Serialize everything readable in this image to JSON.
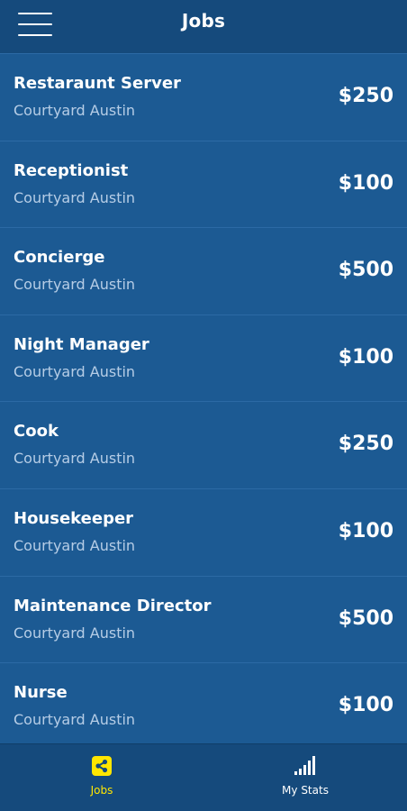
{
  "header": {
    "title": "Jobs",
    "menu_icon": "hamburger-menu-icon"
  },
  "jobs": [
    {
      "title": "Restaraunt Server",
      "location": "Courtyard Austin",
      "pay": "$250"
    },
    {
      "title": "Receptionist",
      "location": "Courtyard Austin",
      "pay": "$100"
    },
    {
      "title": "Concierge",
      "location": "Courtyard Austin",
      "pay": "$500"
    },
    {
      "title": "Night Manager",
      "location": "Courtyard Austin",
      "pay": "$100"
    },
    {
      "title": "Cook",
      "location": "Courtyard Austin",
      "pay": "$250"
    },
    {
      "title": "Housekeeper",
      "location": "Courtyard Austin",
      "pay": "$100"
    },
    {
      "title": "Maintenance Director",
      "location": "Courtyard Austin",
      "pay": "$500"
    },
    {
      "title": "Nurse",
      "location": "Courtyard Austin",
      "pay": "$100"
    }
  ],
  "tabbar": {
    "tabs": [
      {
        "label": "Jobs",
        "icon": "share-icon",
        "active": true
      },
      {
        "label": "My Stats",
        "icon": "signal-bars-icon",
        "active": false
      }
    ]
  },
  "colors": {
    "background": "#1c5a93",
    "header": "#154a7c",
    "accent_active": "#ffe600",
    "text_primary": "#ffffff",
    "text_secondary": "#b6cde6"
  }
}
